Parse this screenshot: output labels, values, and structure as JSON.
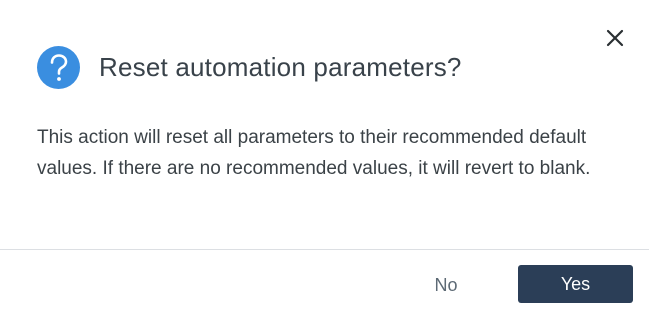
{
  "dialog": {
    "title": "Reset automation parameters?",
    "message": "This action will reset all parameters to their recommended default values. If there are no recommended values, it will revert to blank.",
    "header_icon": "question-circle-icon",
    "close_icon": "close-icon",
    "buttons": {
      "no_label": "No",
      "yes_label": "Yes"
    }
  },
  "colors": {
    "icon_blue": "#3a8ee0",
    "primary_button": "#2b3e57",
    "divider": "#dcdfe3",
    "text": "#3b4247",
    "secondary_text": "#5d6a75"
  }
}
